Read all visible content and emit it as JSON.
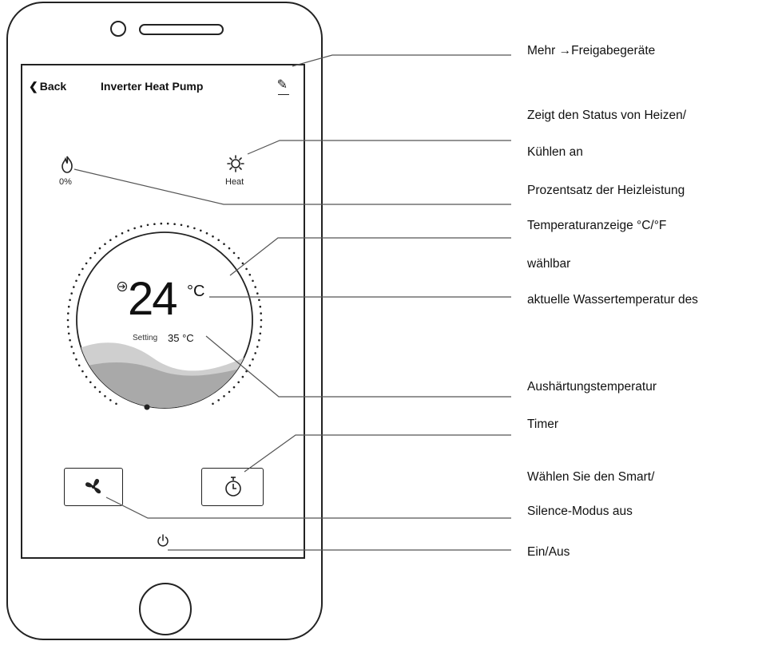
{
  "app": {
    "back_label": "Back",
    "title": "Inverter Heat Pump"
  },
  "status": {
    "power_percent": "0%",
    "mode_label": "Heat"
  },
  "dial": {
    "current_temp": "24",
    "current_unit": "°C",
    "setting_label": "Setting",
    "setting_value": "35 °C"
  },
  "annotations": {
    "share": "Mehr →Freigabegeräte",
    "mode_status_1": "Zeigt den Status von Heizen/",
    "mode_status_2": "Kühlen an",
    "heating_percent": "Prozentsatz der Heizleistung",
    "temp_unit_1": "Temperaturanzeige  °C/°F",
    "temp_unit_2": "wählbar",
    "current_water": "aktuelle Wassertemperatur des",
    "setpoint": "Aushärtungstemperatur",
    "timer": "Timer",
    "smart_1": "Wählen Sie den Smart/",
    "smart_2": "Silence-Modus aus",
    "power": "Ein/Aus"
  },
  "icons": {
    "edit": "pencil-icon",
    "heat_power": "flame-icon",
    "mode": "sun-icon",
    "fan": "fan-icon",
    "timer": "timer-icon",
    "power": "power-icon",
    "inlet": "inlet-arrow-icon"
  },
  "colors": {
    "wave_light": "#cfcfcf",
    "wave_dark": "#a9a9a9",
    "outline": "#222222"
  }
}
